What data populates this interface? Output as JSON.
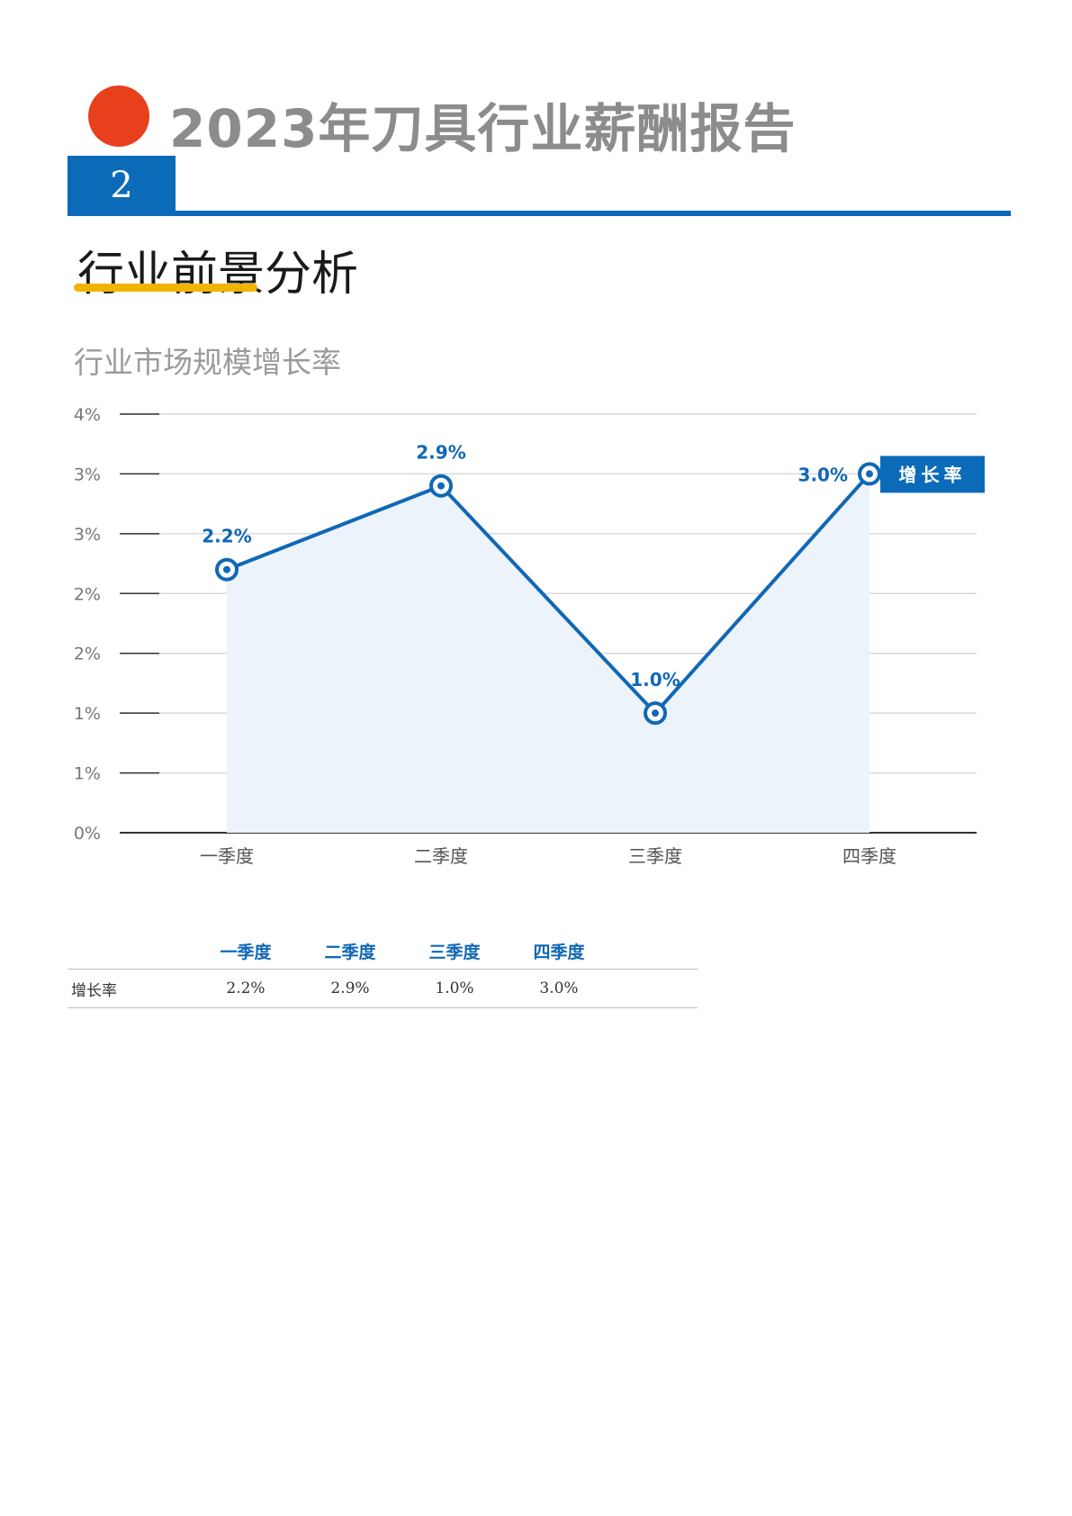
{
  "report": {
    "title": "2023年刀具行业薪酬报告"
  },
  "section": {
    "number": "2",
    "title": "行业前景分析"
  },
  "chart_data": {
    "type": "area",
    "title": "行业市场规模增长率",
    "categories": [
      "一季度",
      "二季度",
      "三季度",
      "四季度"
    ],
    "series": [
      {
        "name": "增长率",
        "values": [
          2.2,
          2.9,
          1.0,
          3.0
        ]
      }
    ],
    "data_labels": [
      "2.2%",
      "2.9%",
      "1.0%",
      "3.0%"
    ],
    "y_tick_labels": [
      "0%",
      "1%",
      "1%",
      "2%",
      "2%",
      "3%",
      "3%",
      "4%"
    ],
    "ylim": [
      0,
      3.5
    ],
    "grid": true,
    "legend_position": "right",
    "colors": {
      "line": "#1068b6",
      "area": "#edf3fa",
      "legend_bg": "#0c6bb8",
      "accent": "#e8401c",
      "underline": "#f2b400"
    }
  },
  "table": {
    "headers": [
      "",
      "一季度",
      "二季度",
      "三季度",
      "四季度",
      ""
    ],
    "rows": [
      [
        "增长率",
        "2.2%",
        "2.9%",
        "1.0%",
        "3.0%",
        ""
      ]
    ]
  }
}
